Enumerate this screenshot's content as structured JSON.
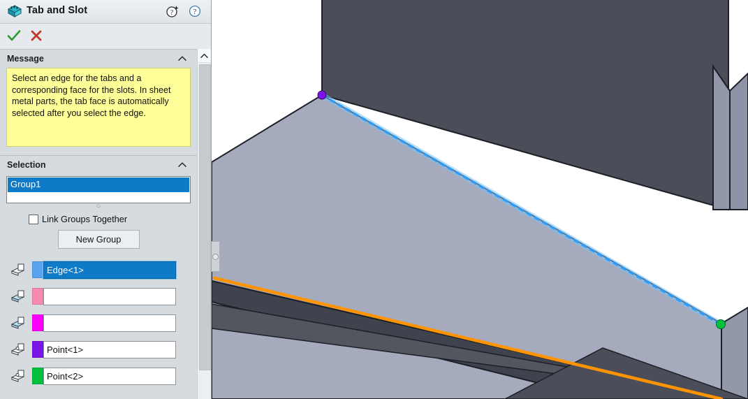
{
  "panel": {
    "title": "Tab and Slot",
    "title_icon": "tab-and-slot-icon",
    "header_icons": [
      {
        "name": "whats-new-help-icon",
        "glyph": "?"
      },
      {
        "name": "help-icon",
        "glyph": "?"
      }
    ],
    "actions": [
      {
        "name": "ok-button",
        "label": "OK",
        "glyph": "✓",
        "color": "#2e9b34"
      },
      {
        "name": "cancel-button",
        "label": "Cancel",
        "glyph": "✕",
        "color": "#c0392b"
      }
    ],
    "scrollbar": {
      "up_arrow": "chevron-up-icon"
    }
  },
  "message_section": {
    "header": "Message",
    "collapsed": false,
    "text": "Select an edge for the tabs and a corresponding face for the slots. In sheet metal parts, the tab face is automatically selected after you select the edge.",
    "background": "#ffff99"
  },
  "selection_section": {
    "header": "Selection",
    "collapsed": false,
    "groups_list": {
      "items": [
        "Group1"
      ],
      "selected": "Group1",
      "selected_color": "#0f7ac7"
    },
    "link_groups_checkbox": {
      "label": "Link Groups Together",
      "checked": false
    },
    "new_group_button": "New Group",
    "rows": [
      {
        "icon": "edge-picker-icon",
        "swatch": "#5aa3ef",
        "value": "Edge<1>",
        "active": true,
        "placeholder": ""
      },
      {
        "icon": "face-picker-icon",
        "swatch": "#f989ae",
        "value": "",
        "active": false,
        "placeholder": ""
      },
      {
        "icon": "face-picker-icon",
        "swatch": "#ff00ff",
        "value": "",
        "active": false,
        "placeholder": ""
      },
      {
        "icon": "vertex-picker-icon",
        "swatch": "#7c13e8",
        "value": "Point<1>",
        "active": false,
        "placeholder": ""
      },
      {
        "icon": "vertex-picker-icon",
        "swatch": "#00c03c",
        "value": "Point<2>",
        "active": false,
        "placeholder": ""
      }
    ]
  },
  "viewport": {
    "name": "3d-graphics-area",
    "background": "#ffffff",
    "model": {
      "top_face_color": "#a5aabd",
      "vertical_face_color": "#4b4e58",
      "edge_color": "#1c1f26",
      "selected_edge_color": "#2f9bf5",
      "highlight_edge_color": "#ff9400",
      "start_point_color": "#7c13e8",
      "end_point_color": "#00c03c"
    },
    "collapse_handle": "panel-collapse-handle"
  }
}
